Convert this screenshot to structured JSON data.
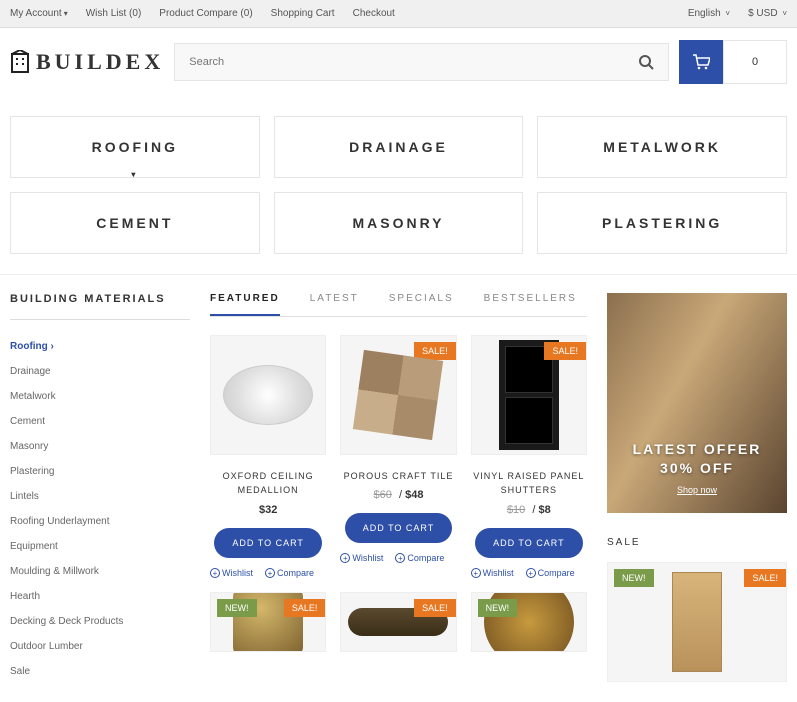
{
  "topbar": {
    "my_account": "My Account",
    "wishlist": "Wish List (0)",
    "compare": "Product Compare (0)",
    "cart": "Shopping Cart",
    "checkout": "Checkout",
    "lang": "English",
    "currency": "$ USD"
  },
  "header": {
    "brand": "BUILDEX",
    "search_placeholder": "Search",
    "cart_count": "0"
  },
  "cats": {
    "c0": "ROOFING",
    "c1": "DRAINAGE",
    "c2": "METALWORK",
    "c3": "CEMENT",
    "c4": "MASONRY",
    "c5": "PLASTERING"
  },
  "sidebar": {
    "title": "BUILDING MATERIALS",
    "items": [
      "Roofing",
      "Drainage",
      "Metalwork",
      "Cement",
      "Masonry",
      "Plastering",
      "Lintels",
      "Roofing Underlayment",
      "Equipment",
      "Moulding & Millwork",
      "Hearth",
      "Decking & Deck Products",
      "Outdoor Lumber",
      "Sale"
    ],
    "active_index": 0
  },
  "tabs": {
    "t0": "FEATURED",
    "t1": "LATEST",
    "t2": "SPECIALS",
    "t3": "BESTSELLERS"
  },
  "products": [
    {
      "name": "OXFORD CEILING MEDALLION",
      "old": "",
      "price": "$32",
      "sale": false,
      "new": false
    },
    {
      "name": "POROUS CRAFT TILE",
      "old": "$60",
      "price": "$48",
      "sale": true,
      "new": false
    },
    {
      "name": "VINYL RAISED PANEL SHUTTERS",
      "old": "$10",
      "price": "$8",
      "sale": true,
      "new": false
    }
  ],
  "buttons": {
    "add": "ADD TO CART",
    "wishlist": "Wishlist",
    "compare": "Compare"
  },
  "badge": {
    "sale": "SALE!",
    "new": "NEW!"
  },
  "offer": {
    "l1": "LATEST OFFER",
    "l2": "30% OFF",
    "shop": "Shop now"
  },
  "rside": {
    "sale_title": "SALE"
  }
}
